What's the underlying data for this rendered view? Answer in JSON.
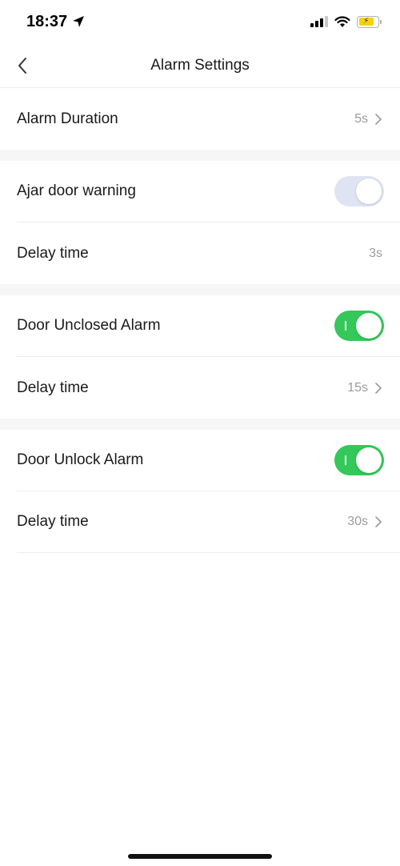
{
  "status_bar": {
    "time": "18:37"
  },
  "nav": {
    "title": "Alarm Settings"
  },
  "sections": [
    {
      "rows": [
        {
          "label": "Alarm Duration",
          "value": "5s",
          "type": "disclosure"
        }
      ]
    },
    {
      "rows": [
        {
          "label": "Ajar door warning",
          "type": "toggle",
          "state": "off-disabled"
        },
        {
          "label": "Delay time",
          "value": "3s",
          "type": "value"
        }
      ]
    },
    {
      "rows": [
        {
          "label": "Door Unclosed Alarm",
          "type": "toggle",
          "state": "on"
        },
        {
          "label": "Delay time",
          "value": "15s",
          "type": "disclosure"
        }
      ]
    },
    {
      "rows": [
        {
          "label": "Door Unlock Alarm",
          "type": "toggle",
          "state": "on"
        },
        {
          "label": "Delay time",
          "value": "30s",
          "type": "disclosure"
        }
      ]
    }
  ],
  "colors": {
    "toggle_on": "#34c85a",
    "toggle_disabled": "#dfe4f3",
    "secondary_text": "#9b9b9b"
  }
}
